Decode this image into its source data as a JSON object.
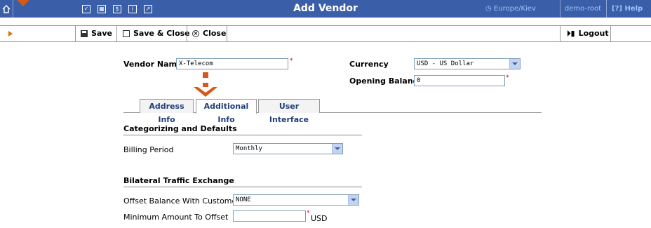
{
  "header": {
    "title": "Add Vendor",
    "timezone": "Europe/Kiev",
    "user": "demo-root",
    "help_label": "Help",
    "icons": [
      "home-icon",
      "checkbox-icon",
      "table-icon",
      "dollar-icon",
      "info-icon",
      "chart-icon",
      "clock-icon",
      "help-icon"
    ]
  },
  "toolbar": {
    "save_label": "Save",
    "save_close_label": "Save & Close",
    "close_label": "Close",
    "logout_label": "Logout"
  },
  "form": {
    "vendor_name_label": "Vendor Name",
    "vendor_name_value": "X-Telecom",
    "currency_label": "Currency",
    "currency_value": "USD - US Dollar",
    "opening_balance_label": "Opening Balance",
    "opening_balance_value": "0"
  },
  "tabs": [
    {
      "label": "Address Info"
    },
    {
      "label": "Additional Info",
      "active": true
    },
    {
      "label": "User Interface"
    }
  ],
  "sections": {
    "categorizing": {
      "title": "Categorizing and Defaults",
      "billing_period_label": "Billing Period",
      "billing_period_value": "Monthly"
    },
    "bilateral": {
      "title": "Bilateral Traffic Exchange",
      "offset_label": "Offset Balance With Customer",
      "offset_value": "NONE",
      "min_amount_label": "Minimum Amount To Offset",
      "min_amount_value": "",
      "min_amount_unit": "USD"
    }
  },
  "colors": {
    "header_bg": "#3a5fa8",
    "accent_orange": "#d35a18",
    "tab_text": "#1f3f77"
  }
}
